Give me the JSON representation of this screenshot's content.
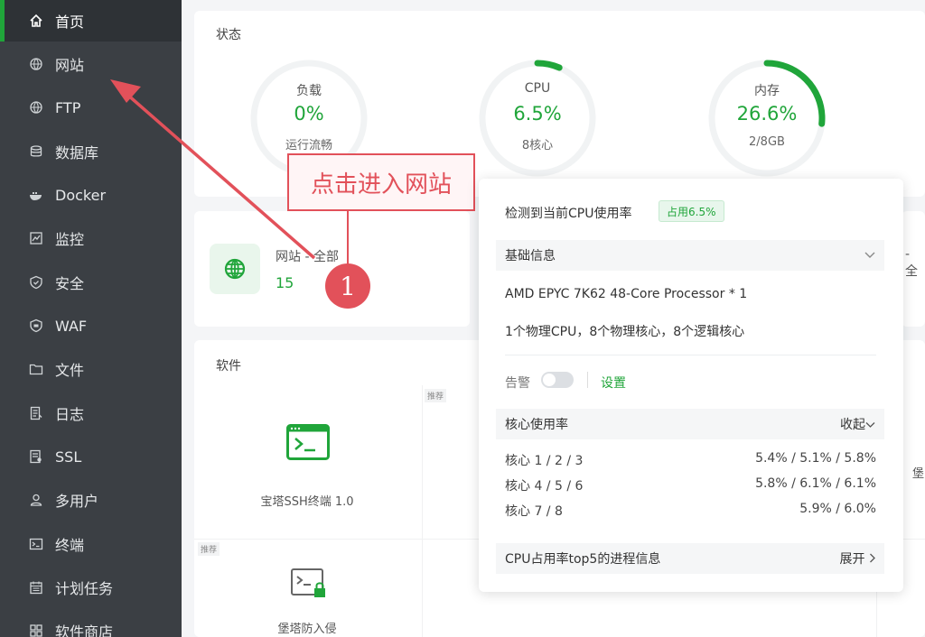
{
  "sidebar": {
    "items": [
      {
        "label": "首页",
        "icon": "home-icon"
      },
      {
        "label": "网站",
        "icon": "globe-icon"
      },
      {
        "label": "FTP",
        "icon": "globe-icon"
      },
      {
        "label": "数据库",
        "icon": "database-icon"
      },
      {
        "label": "Docker",
        "icon": "docker-icon"
      },
      {
        "label": "监控",
        "icon": "monitor-icon"
      },
      {
        "label": "安全",
        "icon": "shield-icon"
      },
      {
        "label": "WAF",
        "icon": "shield-icon"
      },
      {
        "label": "文件",
        "icon": "folder-icon"
      },
      {
        "label": "日志",
        "icon": "log-icon"
      },
      {
        "label": "SSL",
        "icon": "certificate-icon"
      },
      {
        "label": "多用户",
        "icon": "users-icon"
      },
      {
        "label": "终端",
        "icon": "terminal-icon"
      },
      {
        "label": "计划任务",
        "icon": "calendar-icon"
      },
      {
        "label": "软件商店",
        "icon": "grid-icon"
      }
    ]
  },
  "status": {
    "title": "状态",
    "load": {
      "label": "负载",
      "value": "0%",
      "sub": "运行流畅",
      "percent": 0
    },
    "cpu": {
      "label": "CPU",
      "value": "6.5%",
      "sub": "8核心",
      "percent": 6.5
    },
    "memory": {
      "label": "内存",
      "value": "26.6%",
      "sub": "2/8GB",
      "percent": 26.6
    }
  },
  "website": {
    "label": "网站 - 全部",
    "count": "15",
    "right_partial": "- 全"
  },
  "annotation": {
    "callout": "点击进入网站",
    "step": "1"
  },
  "software": {
    "title": "软件",
    "tag": "推荐",
    "items": [
      {
        "name": "宝塔SSH终端 1.0"
      },
      {
        "name": "堡塔防入侵"
      }
    ],
    "right_partial": "堡"
  },
  "cpu_popup": {
    "heading": "检测到当前CPU使用率",
    "usage_tag": "占用6.5%",
    "basic_info": "基础信息",
    "processor": "AMD EPYC 7K62 48-Core Processor * 1",
    "cores_desc": "1个物理CPU，8个物理核心，8个逻辑核心",
    "alarm_label": "告警",
    "settings_label": "设置",
    "core_usage_title": "核心使用率",
    "collapse_label": "收起",
    "cores": [
      {
        "label": "核心 1 / 2 / 3",
        "value": "5.4% / 5.1% / 5.8%"
      },
      {
        "label": "核心 4 / 5 / 6",
        "value": "5.8% / 6.1% / 6.1%"
      },
      {
        "label": "核心 7 / 8",
        "value": "5.9% / 6.0%"
      }
    ],
    "top5_title": "CPU占用率top5的进程信息",
    "expand_label": "展开"
  },
  "colors": {
    "accent": "#20a53a",
    "sidebar": "#3b3f44",
    "annotation": "#e2515a"
  }
}
